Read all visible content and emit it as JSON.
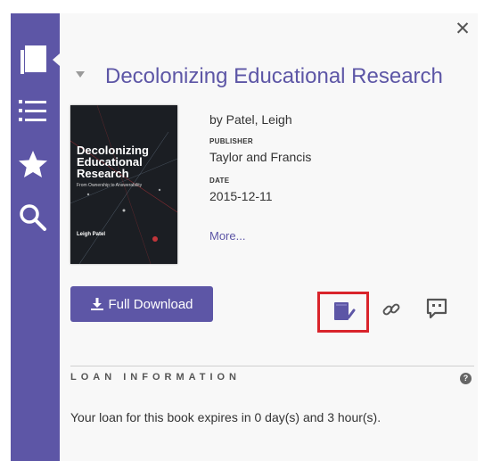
{
  "sidebar": {
    "items": [
      {
        "icon": "book-icon",
        "active": true
      },
      {
        "icon": "list-icon"
      },
      {
        "icon": "star-icon"
      },
      {
        "icon": "search-icon"
      }
    ]
  },
  "panel": {
    "close_label": "✕",
    "title": "Decolonizing Educational Research",
    "cover": {
      "title": "Decolonizing Educational Research",
      "subtitle": "From Ownership to Answerability",
      "author": "Leigh Patel"
    },
    "author_line": "by Patel, Leigh",
    "publisher_label": "PUBLISHER",
    "publisher": "Taylor and Francis",
    "date_label": "DATE",
    "date": "2015-12-11",
    "more_link": "More..."
  },
  "actions": {
    "download_label": "Full Download",
    "icons": [
      "add-to-shelf-icon",
      "link-icon",
      "comment-icon"
    ]
  },
  "loan": {
    "heading": "LOAN INFORMATION",
    "help_label": "?",
    "text": "Your loan for this book expires in 0 day(s) and 3 hour(s)."
  },
  "colors": {
    "brand": "#5d56a6",
    "highlight": "#d9242b",
    "panel_bg": "#f8f8f8"
  }
}
